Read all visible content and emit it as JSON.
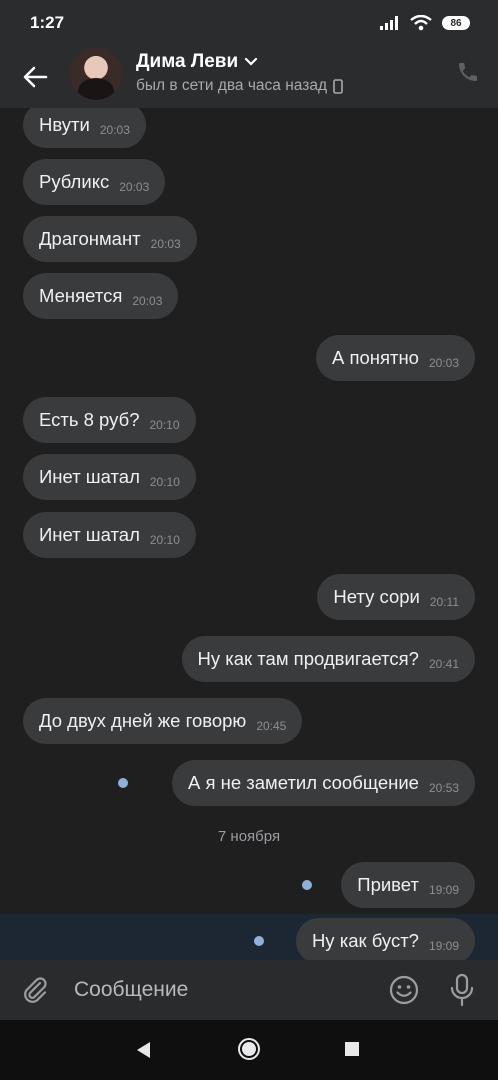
{
  "status_bar": {
    "time": "1:27",
    "battery": "86"
  },
  "header": {
    "name": "Дима Леви",
    "status": "был в сети два часа назад",
    "icons": [
      "back-arrow-icon",
      "chevron-down-icon",
      "mobile-device-icon",
      "phone-icon"
    ]
  },
  "messages": [
    {
      "dir": "in",
      "text": "Нвути",
      "time": "20:03"
    },
    {
      "dir": "in",
      "text": "Рубликс",
      "time": "20:03"
    },
    {
      "dir": "in",
      "text": "Драгонмант",
      "time": "20:03"
    },
    {
      "dir": "in",
      "text": "Меняется",
      "time": "20:03"
    },
    {
      "dir": "out",
      "text": "А понятно",
      "time": "20:03"
    },
    {
      "dir": "in",
      "text": "Есть 8 руб?",
      "time": "20:10"
    },
    {
      "dir": "in",
      "text": "Инет шатал",
      "time": "20:10"
    },
    {
      "dir": "in",
      "text": "Инет шатал",
      "time": "20:10"
    },
    {
      "dir": "out",
      "text": "Нету сори",
      "time": "20:11"
    },
    {
      "dir": "out",
      "text": "Ну как там продвигается?",
      "time": "20:41"
    },
    {
      "dir": "in",
      "text": "До двух дней же говорю",
      "time": "20:45"
    },
    {
      "dir": "out",
      "text": "А я не заметил сообщение",
      "time": "20:53",
      "unread": true
    },
    {
      "dir": "out",
      "text": "Привет",
      "time": "19:09",
      "unread": true
    },
    {
      "dir": "out",
      "text": "Ну как буст?",
      "time": "19:09",
      "unread": true
    }
  ],
  "date_separator": "7 ноября",
  "composer": {
    "placeholder": "Сообщение",
    "icons": [
      "paperclip-icon",
      "emoji-icon",
      "microphone-icon"
    ]
  },
  "nav": {
    "icons": [
      "nav-back-icon",
      "nav-home-icon",
      "nav-recents-icon"
    ]
  },
  "colors": {
    "background": "#1f1f20",
    "bubble": "#3a3b3d",
    "unread_dot": "#8fb0d8",
    "highlight": "#1d2733"
  }
}
